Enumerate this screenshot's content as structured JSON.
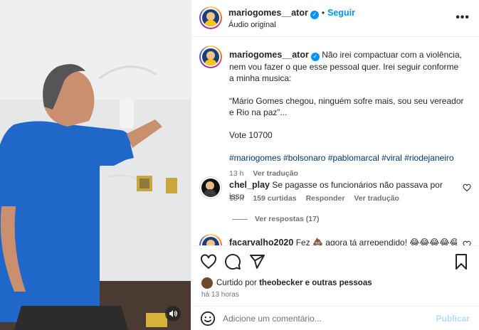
{
  "post": {
    "username": "mariogomes__ator",
    "follow_label": "Seguir",
    "audio_label": "Áudio original",
    "more_label": "•••"
  },
  "caption": {
    "username": "mariogomes__ator",
    "text": "Não irei compactuar com a violência, nem vou fazer o que esse pessoal quer. Irei seguir conforme a minha musica:",
    "quote": "“Mário Gomes chegou, ninguém sofre mais, sou seu vereador e Rio na paz”...",
    "vote": "Vote 10700",
    "hashtags": [
      "#mariogomes",
      "#bolsonaro",
      "#pablomarcal",
      "#viral",
      "#riodejaneiro"
    ],
    "time": "13 h",
    "translate_label": "Ver tradução"
  },
  "comments": [
    {
      "username": "chel_play",
      "text": "Se pagasse os funcionários não passava por isso",
      "time": "13 h",
      "likes": "159 curtidas",
      "reply_label": "Responder",
      "translate_label": "Ver tradução",
      "view_replies": "Ver respostas (17)"
    },
    {
      "username": "facarvalho2020",
      "text": "Fez 💩 agora tá arrependido! 😂😂😂😂😂"
    }
  ],
  "likes_line": {
    "prefix": "Curtido por",
    "user": "theobecker",
    "suffix": "e outras pessoas"
  },
  "time_ago": "há 13 horas",
  "comment_box": {
    "placeholder": "Adicione um comentário...",
    "publish_label": "Publicar"
  },
  "colors": {
    "accent": "#0095f6",
    "publish_disabled": "#b3dbff",
    "hashtag": "#00376b",
    "muted": "#737373"
  },
  "icons": [
    "heart-icon",
    "comment-icon",
    "share-icon",
    "bookmark-icon",
    "emoji-icon",
    "volume-icon",
    "more-icon",
    "verified-icon"
  ]
}
